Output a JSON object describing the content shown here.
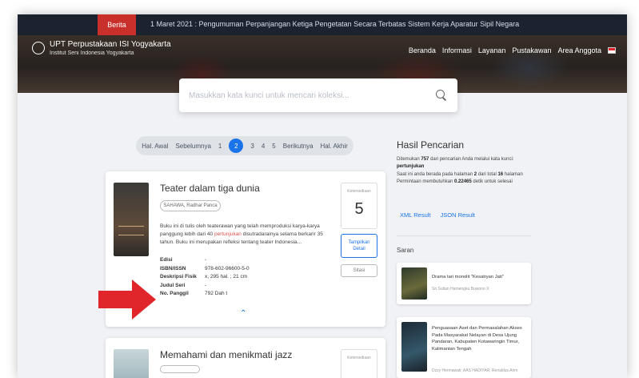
{
  "newsbar": {
    "badge": "Berita",
    "text": "1 Maret 2021 : Pengumuman Perpanjangan Ketiga Pengetatan Secara Terbatas Sistem Kerja Aparatur Sipil Negara"
  },
  "header": {
    "title": "UPT Perpustakaan ISI Yogyakarta",
    "subtitle": "Institut Seni Indonesia Yogyakarta",
    "nav": [
      "Beranda",
      "Informasi",
      "Layanan",
      "Pustakawan",
      "Area Anggota"
    ]
  },
  "search": {
    "placeholder": "Masukkan kata kunci untuk mencari koleksi..."
  },
  "pagination": {
    "first": "Hal. Awal",
    "prev": "Sebelumnya",
    "pages": [
      "1",
      "2",
      "3",
      "4",
      "5"
    ],
    "current": "2",
    "next": "Berikutnya",
    "last": "Hal. Akhir"
  },
  "results": [
    {
      "title": "Teater dalam tiga dunia",
      "author": "SAHAWA, Radhar Panca",
      "abstract_before": "Buku ini di tulis oleh teaterawan yang telah memproduksi karya-karya panggung lebih dari 40 ",
      "abstract_highlight": "pertunjukan",
      "abstract_after": " disutradarainya selama berkarir 35 tahun. Buku ini merupakan refleksi tentang teater Indonesia...",
      "meta": [
        {
          "key": "Edisi",
          "value": "-"
        },
        {
          "key": "ISBN/ISSN",
          "value": "978-602-96600-5-0"
        },
        {
          "key": "Deskripsi Fisik",
          "value": "x, 295 hal. ; 21 cm"
        },
        {
          "key": "Judul Seri",
          "value": "-"
        },
        {
          "key": "No. Panggil",
          "value": "792 Dah t"
        }
      ],
      "count_label": "Ketersediaan",
      "count": "5",
      "detail_label": "Tampilkan Detail",
      "share_label": "Sitasi"
    },
    {
      "title": "Memahami dan menikmati jazz",
      "count_label": "Ketersediaan"
    }
  ],
  "result_panel": {
    "title": "Hasil Pencarian",
    "found_before": "Ditemukan ",
    "found_count": "757",
    "found_after": " dari pencarian Anda melalui kata kunci:",
    "keyword": "pertunjukan",
    "page_before": "Saat ini anda berada pada halaman ",
    "page_current": "2",
    "page_mid": " dari total ",
    "page_total": "16",
    "page_after": " halaman",
    "time_before": "Permintaan membutuhkan ",
    "time_value": "0.22465",
    "time_after": " detik untuk selesai",
    "xml_link": "XML Result",
    "json_link": "JSON Result"
  },
  "suggestions": {
    "title": "Saran",
    "items": [
      {
        "title": "Drama tari monolit \"Kesatryan Jati\"",
        "subtitle": "Sri Sultan Hamengku Buwono X"
      },
      {
        "title": "Penguasaan Aset dan Permasalahan Akses Pada Masyarakat Nelayan di Desa Ujung Pandaran, Kabupaten Kotawaringin Timur, Kalimantan Tengah",
        "subtitle": "Dzzy Hermawati; AAS HADIYAR; Renaldus Arim"
      }
    ]
  }
}
